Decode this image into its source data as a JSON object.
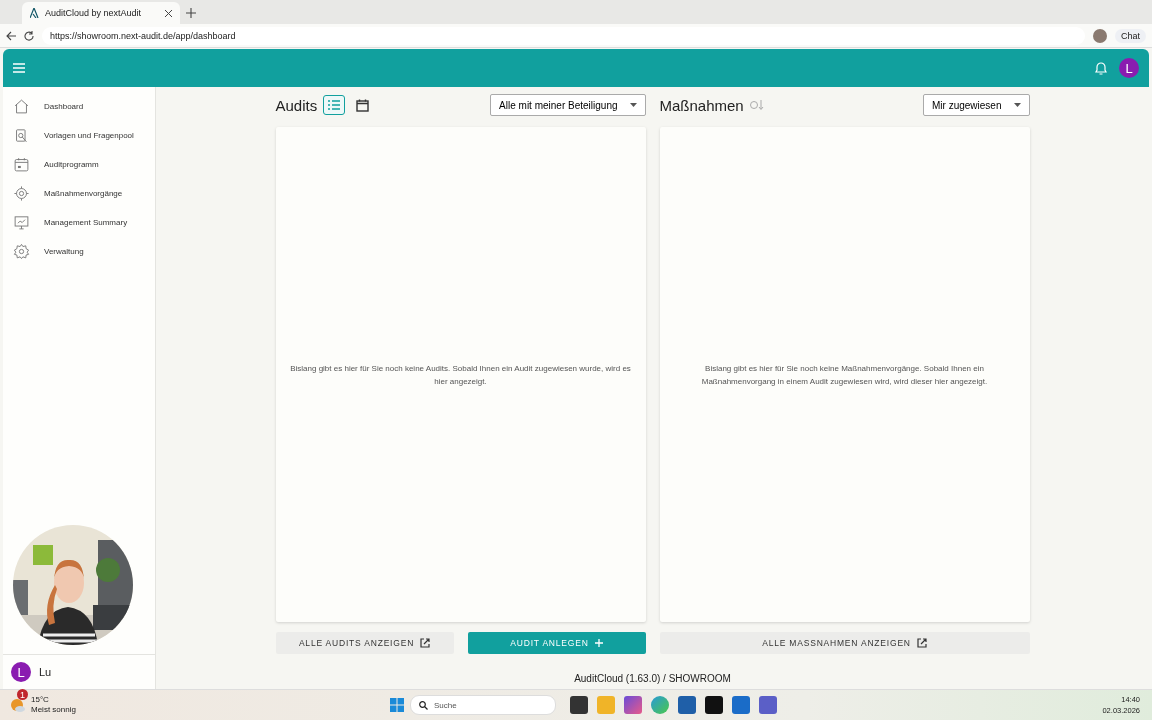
{
  "browser": {
    "tab_title": "AuditCloud by nextAudit",
    "url": "https://showroom.next-audit.de/app/dashboard",
    "chat_label": "Chat"
  },
  "header": {
    "avatar": "L"
  },
  "sidebar": {
    "items": [
      {
        "label": "Dashboard"
      },
      {
        "label": "Vorlagen und Fragenpool"
      },
      {
        "label": "Auditprogramm"
      },
      {
        "label": "Maßnahmenvorgänge"
      },
      {
        "label": "Management Summary"
      },
      {
        "label": "Verwaltung"
      }
    ],
    "user": {
      "avatar": "L",
      "name": "Lu"
    }
  },
  "audits": {
    "title": "Audits",
    "views": [
      {
        "kind": "list",
        "selected": true
      },
      {
        "kind": "calendar",
        "selected": false
      }
    ],
    "filter": "Alle mit meiner Beteiligung",
    "empty_message": "Bislang gibt es hier für Sie noch keine Audits. Sobald Ihnen ein Audit zugewiesen wurde, wird es hier angezeigt."
  },
  "measures": {
    "title": "Maßnahmen",
    "filter": "Mir zugewiesen",
    "empty_message": "Bislang gibt es hier für Sie noch keine Maßnahmenvorgänge. Sobald Ihnen ein Maßnahmenvorgang in einem Audit zugewiesen wird, wird dieser hier angezeigt."
  },
  "buttons": [
    {
      "label": "ALLE AUDITS ANZEIGEN",
      "kind": "external"
    },
    {
      "label": "AUDIT ANLEGEN",
      "kind": "primary"
    },
    {
      "label": "ALLE MASSNAHMEN ANZEIGEN",
      "kind": "external"
    }
  ],
  "footer": "AuditCloud (1.63.0) / SHOWROOM",
  "taskbar": {
    "weather_badge": "1",
    "temperature": "15°C",
    "weather": "Meist sonnig",
    "search_placeholder": "Suche",
    "time": "14:40",
    "date": "02.03.2026"
  }
}
